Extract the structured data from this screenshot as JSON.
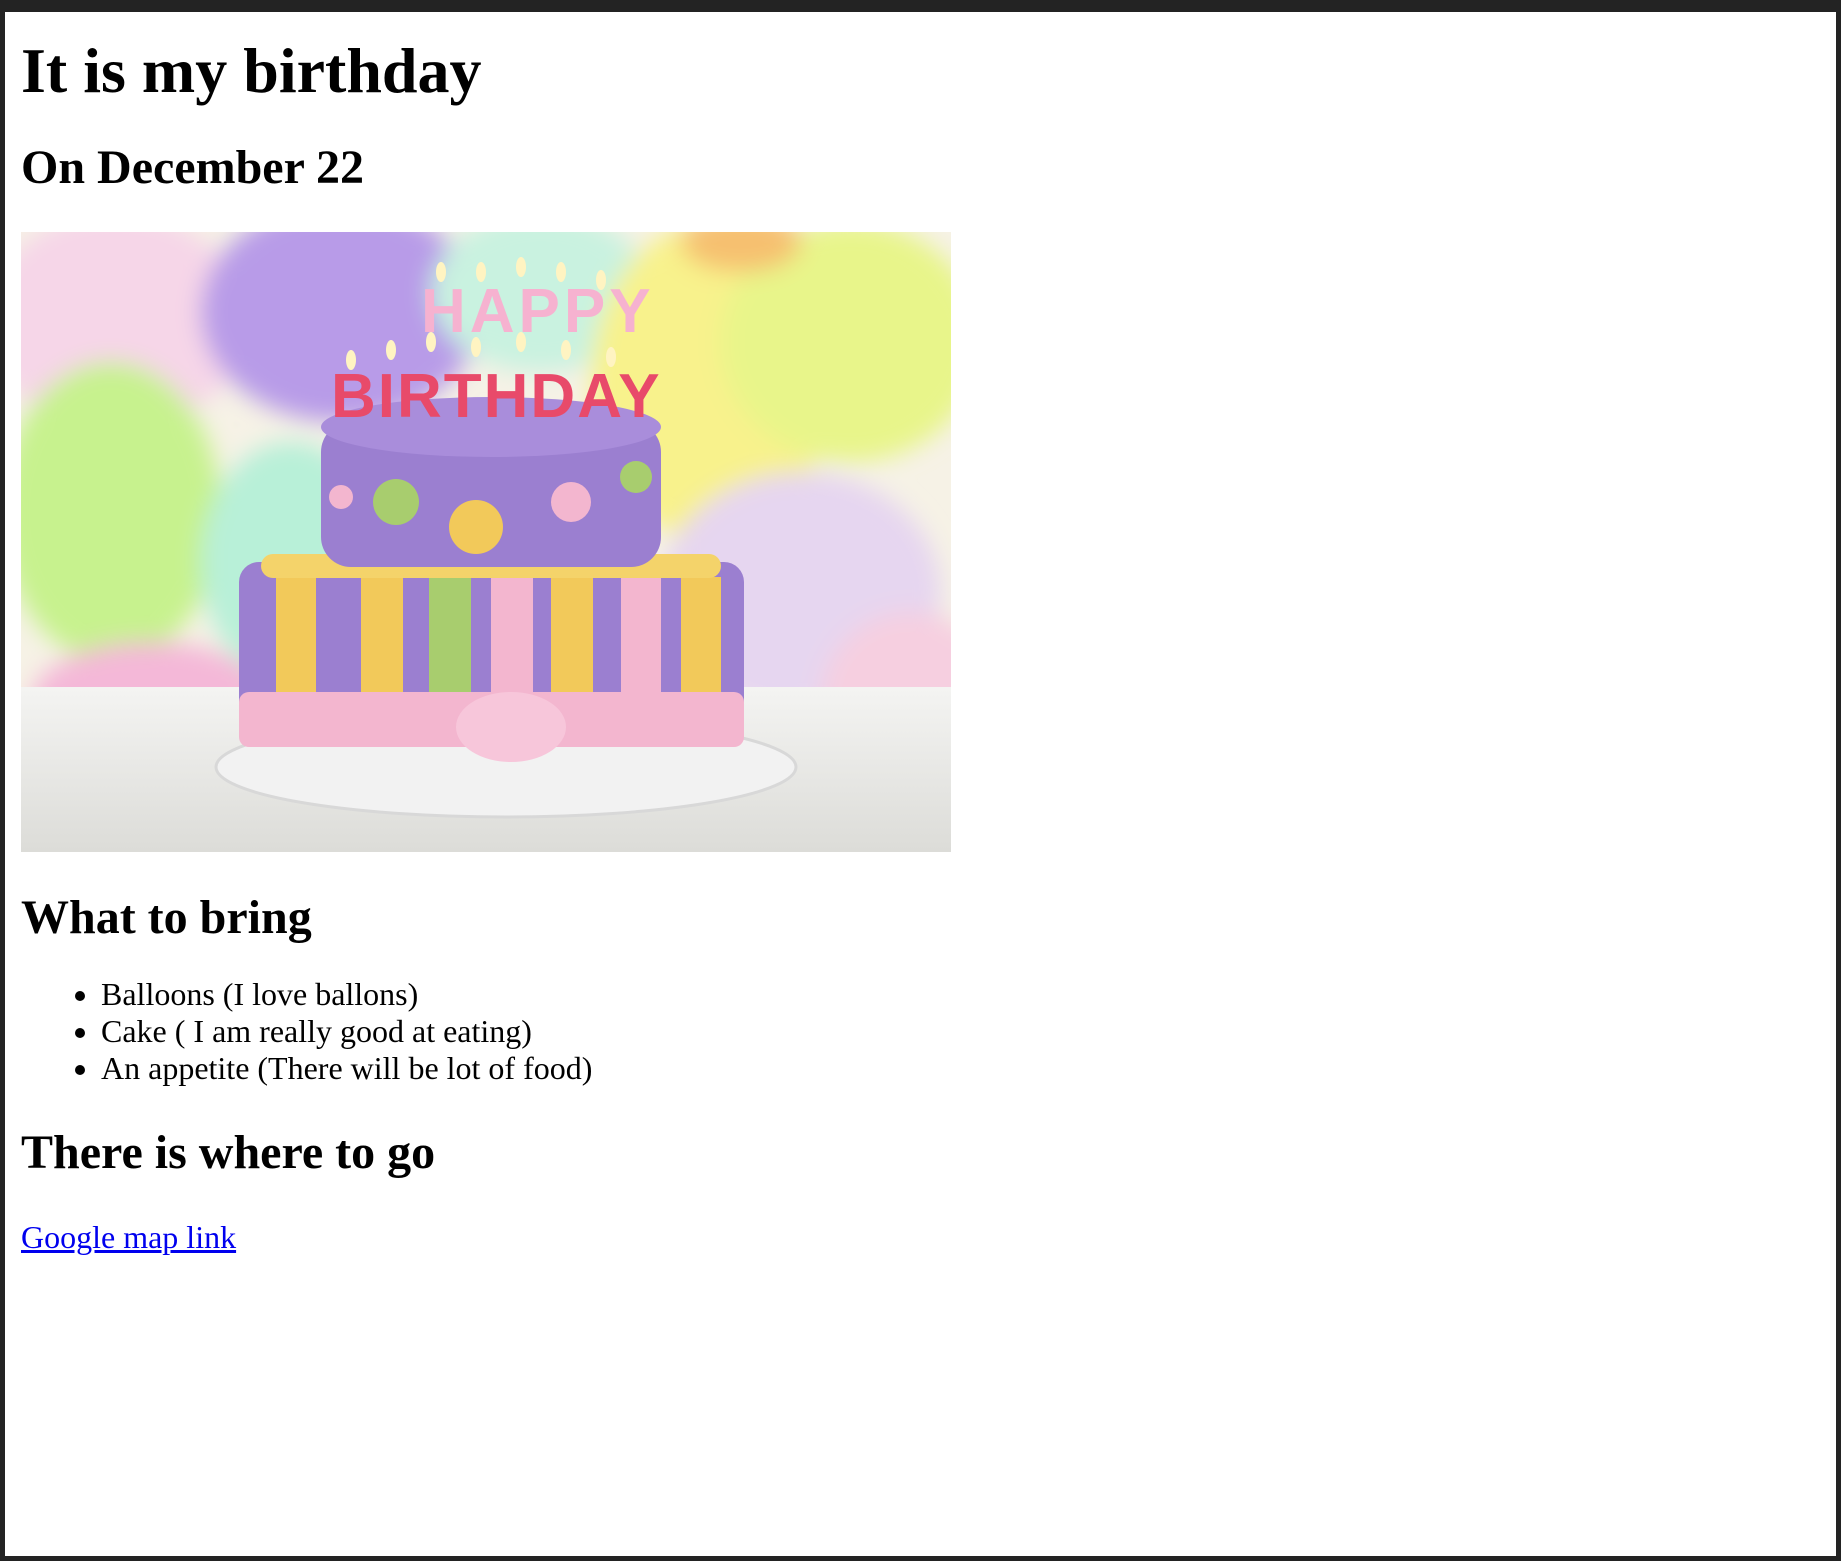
{
  "page": {
    "title": "It is my birthday",
    "date_heading": "On December 22",
    "image": {
      "banner_text_top": "HAPPY",
      "banner_text_bottom": "BIRTHDAY"
    },
    "bring_section": {
      "heading": "What to bring",
      "items": [
        "Balloons (I love ballons)",
        "Cake ( I am really good at eating)",
        "An appetite (There will be lot of food)"
      ]
    },
    "location_section": {
      "heading": "There is where to go",
      "link_label": "Google map link"
    }
  },
  "colors": {
    "link": "#0000ee",
    "frame": "#232323",
    "cake_purple": "#9b7fd0",
    "cake_pink": "#f3b6cf",
    "cake_yellow": "#f2c95a",
    "cake_green": "#a8cd6e"
  }
}
